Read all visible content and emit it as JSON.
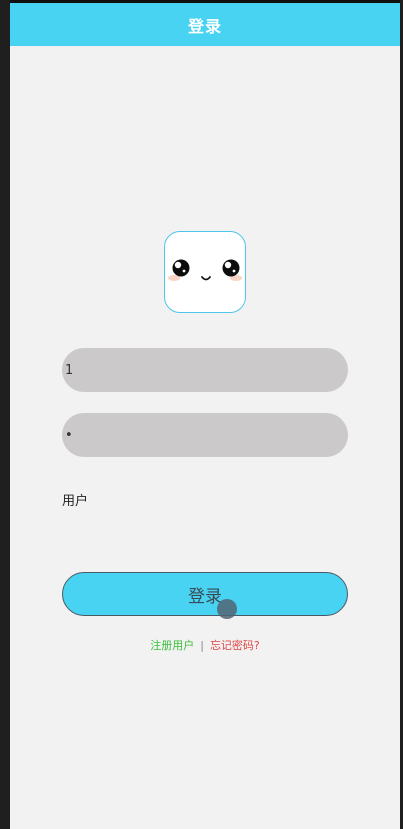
{
  "header": {
    "title": "登录"
  },
  "form": {
    "username_value": "1",
    "password_value": "1",
    "role_label": "用户",
    "login_label": "登录"
  },
  "links": {
    "register": "注册用户",
    "separator": "|",
    "forgot": "忘记密码?"
  },
  "colors": {
    "accent": "#49d3f2",
    "background": "#f2f2f2",
    "field": "#cbc9ca",
    "register": "#3cbf3c",
    "forgot": "#e04848"
  },
  "icons": {
    "avatar": "cute-face-icon"
  }
}
